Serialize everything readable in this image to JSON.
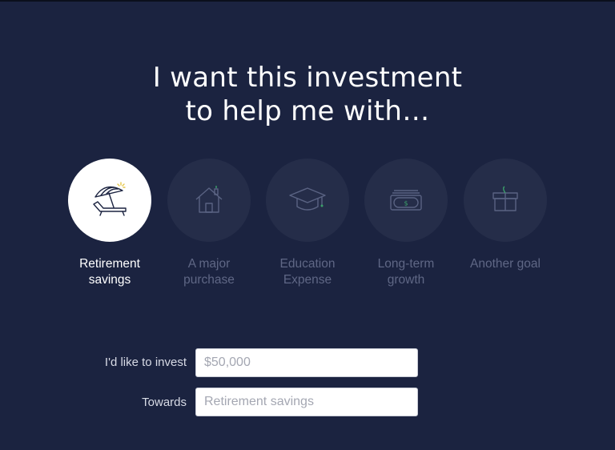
{
  "heading": {
    "line1": "I want this investment",
    "line2": "to help me with…"
  },
  "goals": [
    {
      "line1": "Retirement",
      "line2": "savings",
      "icon": "beach-umbrella-icon",
      "selected": true
    },
    {
      "line1": "A major",
      "line2": "purchase",
      "icon": "house-icon",
      "selected": false
    },
    {
      "line1": "Education",
      "line2": "Expense",
      "icon": "graduation-cap-icon",
      "selected": false
    },
    {
      "line1": "Long-term",
      "line2": "growth",
      "icon": "money-bill-icon",
      "selected": false
    },
    {
      "line1": "Another goal",
      "line2": "",
      "icon": "gift-box-icon",
      "selected": false
    }
  ],
  "form": {
    "invest_label": "I'd like to invest",
    "invest_placeholder": "$50,000",
    "towards_label": "Towards",
    "towards_placeholder": "Retirement savings"
  },
  "colors": {
    "background": "#1b2340",
    "circle_inactive": "#252d49",
    "circle_active": "#ffffff",
    "label_inactive": "#5f6785",
    "accent_yellow": "#e6c74a",
    "accent_green": "#3ba06a"
  }
}
